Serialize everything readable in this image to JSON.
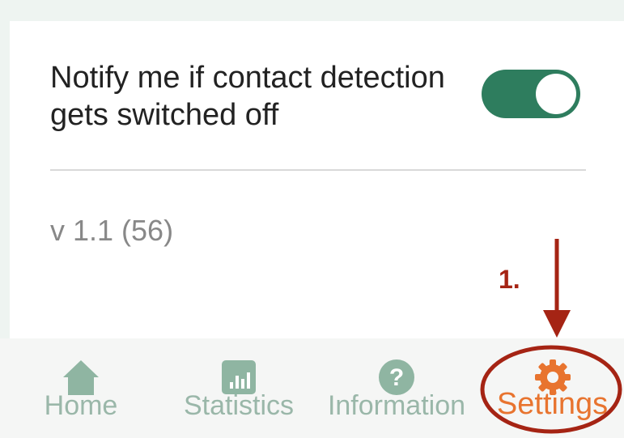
{
  "settings": {
    "notify_label": "Notify me if contact detection gets switched off",
    "notify_enabled": true,
    "version": "v 1.1 (56)"
  },
  "annotation": {
    "step_label": "1."
  },
  "nav": {
    "items": [
      {
        "label": "Home",
        "icon": "home-icon"
      },
      {
        "label": "Statistics",
        "icon": "bar-chart-icon"
      },
      {
        "label": "Information",
        "icon": "question-icon"
      },
      {
        "label": "Settings",
        "icon": "gear-icon",
        "active": true
      }
    ]
  },
  "colors": {
    "toggle_on": "#2e7d5e",
    "nav_inactive": "#9ab7a9",
    "nav_active": "#e8742f",
    "annotation": "#a52414"
  }
}
